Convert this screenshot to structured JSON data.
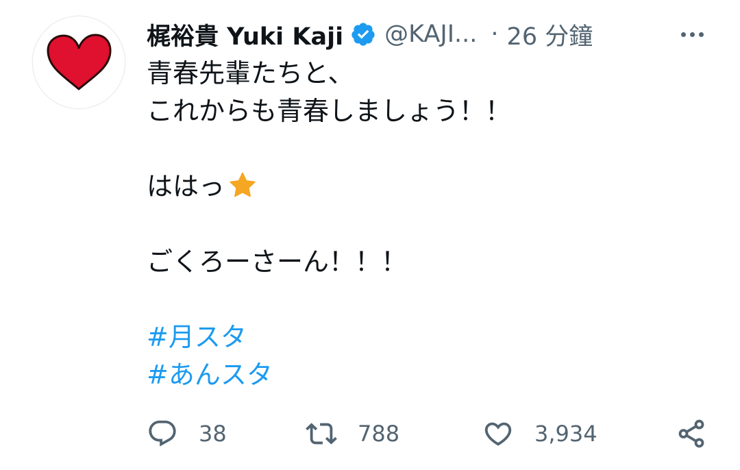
{
  "author": {
    "display_name": "梶裕貴 Yuki Kaji",
    "handle": "@KAJI...",
    "separator": "·",
    "time": "26 分鐘",
    "verified": true,
    "avatar_icon": "red-heart-icon"
  },
  "tweet": {
    "lines": [
      "青春先輩たちと、",
      "これからも青春しましょう！！",
      "",
      "ははっ",
      "",
      "ごくろーさーん！！！",
      ""
    ],
    "emoji": "star-emoji",
    "hashtags": [
      "#月スタ",
      "#あんスタ"
    ]
  },
  "actions": {
    "reply_count": "38",
    "retweet_count": "788",
    "like_count": "3,934"
  },
  "colors": {
    "link": "#1d9bf0",
    "secondary": "#536471",
    "verified": "#1d9bf0",
    "heart": "#e0102f"
  }
}
